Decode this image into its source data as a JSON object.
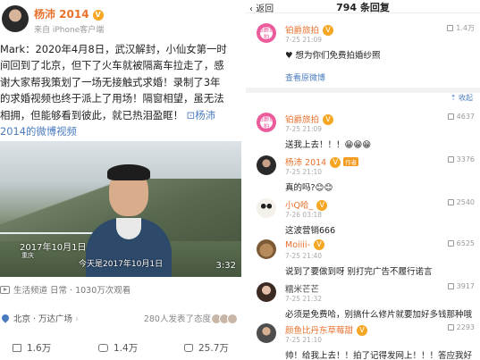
{
  "left": {
    "author": "杨沛 2014",
    "author_badge": "V",
    "source": "来自 iPhone客户端",
    "post_lines": [
      "Mark：2020年4月8日，武汉解封，小仙女第一时",
      "间回到了北京，但下了火车就被隔离车拉走了，感",
      "谢大家帮我策划了一场无接触式求婚！录制了3年",
      "的求婚视频也终于派上了用场！隔窗相望，虽无法",
      "相拥，但能够看到彼此，就已热泪盈眶！"
    ],
    "video_link_suffix": "杨沛",
    "video_link_line2": "2014的微博视频",
    "video": {
      "date_overlay": "2017年10月1日",
      "place_overlay": "重庆",
      "caption": "今天是2017年10月1日",
      "duration": "3:32"
    },
    "channel_info": "生活频道 日常 · 1030万次观看",
    "location": "北京 · 万达广场",
    "attitude": "280人发表了态度",
    "actions": {
      "share": "1.6万",
      "comment": "1.4万",
      "like": "25.7万"
    }
  },
  "right": {
    "back_label": "返回",
    "count_label": "794 条回复",
    "collapse_label": "收起",
    "see_original": "查看原微博",
    "comments": [
      {
        "name": "铂爵旅拍",
        "time": "7-25 21:09",
        "text": "♥ 想为你们免费拍婚纱照",
        "likes": "1.4万",
        "avatar": "brand",
        "avatar_text": "铂爵旅拍"
      },
      {
        "name": "铂爵旅拍",
        "time": "7-25 21:09",
        "text": "送我上去！！！😁😁😁",
        "likes": "4637",
        "avatar": "brand",
        "avatar_text": "铂爵旅拍"
      },
      {
        "name": "杨沛 2014",
        "time": "7-25 21:10",
        "text": "真的吗?😊😊",
        "likes": "3376",
        "avatar": "dark",
        "badge": "作者"
      },
      {
        "name": "小Q哈_",
        "time": "7-26 03:18",
        "text": "这波营销666",
        "likes": "2540",
        "avatar": "panda"
      },
      {
        "name": "Moiiii-",
        "time": "7-25 21:40",
        "text": "说到了要做到呀 别打完广告不履行诺言",
        "likes": "6525",
        "avatar": "animal"
      },
      {
        "name": "糯米芒芒",
        "time": "7-25 21:32",
        "text": "必须是免费哈，别搞什么修片就要加好多钱那种哦",
        "likes": "3917",
        "avatar": "woman"
      },
      {
        "name": "颜鱼比丹东草莓甜",
        "time": "7-25 21:10",
        "text": "帅！给我上去！！拍了记得发网上！！！答应我好",
        "likes": "2293",
        "avatar": "man"
      }
    ]
  }
}
